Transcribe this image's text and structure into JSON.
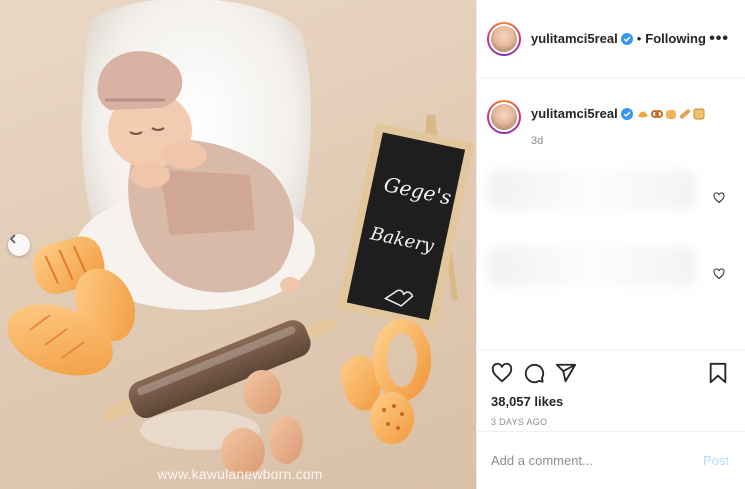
{
  "post": {
    "username": "yulitamci5real",
    "follow_separator": "•",
    "follow_state": "Following",
    "more_label": "•••",
    "watermark": "www.kawulanewborn.com",
    "chalkboard": {
      "line1": "Gege's",
      "line2": "Bakery"
    }
  },
  "caption": {
    "username": "yulitamci5real",
    "emojis": [
      "croissant-emoji",
      "pretzel-emoji",
      "bread-emoji",
      "baguette-emoji",
      "toast-emoji"
    ],
    "time": "3d"
  },
  "actions": {
    "likes": "38,057 likes",
    "date": "3 DAYS AGO"
  },
  "comment_box": {
    "placeholder": "Add a comment...",
    "post_label": "Post"
  },
  "icons": {
    "verified": "verified-badge-icon",
    "heart": "heart-icon",
    "comment": "comment-icon",
    "share": "share-icon",
    "bookmark": "bookmark-icon",
    "prev": "chevron-left-icon"
  },
  "colors": {
    "verified": "#3897f0",
    "post_button_disabled": "#b3dbff",
    "muted_text": "#8e8e8e"
  }
}
